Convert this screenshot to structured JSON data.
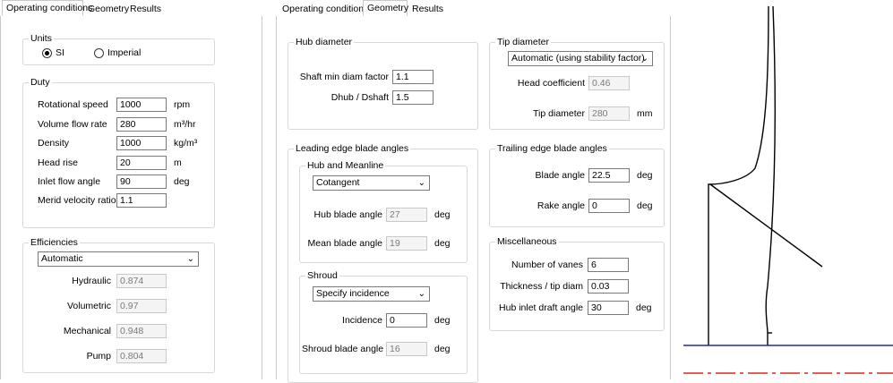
{
  "panel1": {
    "tabs": [
      "Operating conditions",
      "Geometry",
      "Results"
    ],
    "units": {
      "title": "Units",
      "options": [
        "SI",
        "Imperial"
      ],
      "selected": "SI"
    },
    "duty": {
      "title": "Duty",
      "rows": [
        {
          "label": "Rotational speed",
          "value": "1000",
          "unit": "rpm"
        },
        {
          "label": "Volume flow rate",
          "value": "280",
          "unit": "m³/hr"
        },
        {
          "label": "Density",
          "value": "1000",
          "unit": "kg/m³"
        },
        {
          "label": "Head rise",
          "value": "20",
          "unit": "m"
        },
        {
          "label": "Inlet flow angle",
          "value": "90",
          "unit": "deg"
        },
        {
          "label": "Merid velocity ratio",
          "value": "1.1",
          "unit": ""
        }
      ]
    },
    "efficiencies": {
      "title": "Efficiencies",
      "mode": "Automatic",
      "rows": [
        {
          "label": "Hydraulic",
          "value": "0.874"
        },
        {
          "label": "Volumetric",
          "value": "0.97"
        },
        {
          "label": "Mechanical",
          "value": "0.948"
        },
        {
          "label": "Pump",
          "value": "0.804"
        }
      ]
    }
  },
  "panel2": {
    "tabs": [
      "Operating conditions",
      "Geometry",
      "Results"
    ],
    "hub_diameter": {
      "title": "Hub diameter",
      "rows": [
        {
          "label": "Shaft min diam factor",
          "value": "1.1"
        },
        {
          "label": "Dhub / Dshaft",
          "value": "1.5"
        }
      ]
    },
    "tip_diameter": {
      "title": "Tip diameter",
      "mode": "Automatic (using stability factor)",
      "head_coefficient_label": "Head coefficient",
      "head_coefficient_value": "0.46",
      "tip_diameter_label": "Tip diameter",
      "tip_diameter_value": "280",
      "tip_diameter_unit": "mm"
    },
    "leading_edge": {
      "title": "Leading edge blade angles",
      "hub_meanline": {
        "title": "Hub and Meanline",
        "mode": "Cotangent",
        "hub_label": "Hub blade angle",
        "hub_value": "27",
        "mean_label": "Mean blade angle",
        "mean_value": "19",
        "unit": "deg"
      },
      "shroud": {
        "title": "Shroud",
        "mode": "Specify incidence",
        "incidence_label": "Incidence",
        "incidence_value": "0",
        "shroud_label": "Shroud blade angle",
        "shroud_value": "16",
        "unit": "deg"
      }
    },
    "trailing_edge": {
      "title": "Trailing edge blade angles",
      "blade_label": "Blade angle",
      "blade_value": "22.5",
      "rake_label": "Rake angle",
      "rake_value": "0",
      "unit": "deg"
    },
    "misc": {
      "title": "Miscellaneous",
      "vanes_label": "Number of vanes",
      "vanes_value": "6",
      "thickness_label": "Thickness / tip diam",
      "thickness_value": "0.03",
      "draft_label": "Hub inlet draft angle",
      "draft_value": "30",
      "draft_unit": "deg"
    }
  },
  "colors": {
    "axis_line": "#1f2bb3",
    "centerline": "#e0261f",
    "outline": "#000000"
  }
}
